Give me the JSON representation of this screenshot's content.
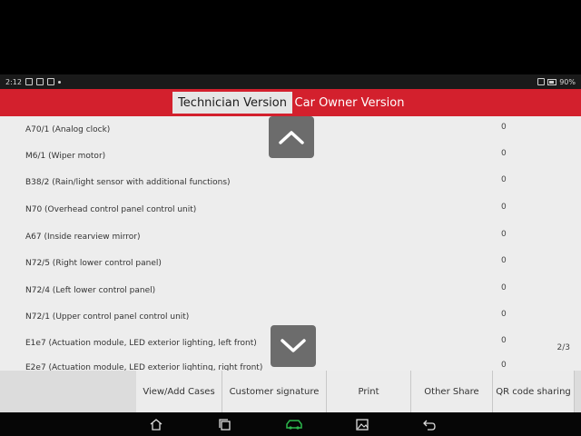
{
  "status_bar": {
    "time": "2:12",
    "battery": "90%"
  },
  "tabs": {
    "technician": "Technician Version",
    "car_owner": "Car Owner Version"
  },
  "rows": [
    {
      "name": "A70/1 (Analog clock)",
      "value": "0"
    },
    {
      "name": "M6/1 (Wiper motor)",
      "value": "0"
    },
    {
      "name": "B38/2 (Rain/light sensor with additional functions)",
      "value": "0"
    },
    {
      "name": "N70 (Overhead control panel control unit)",
      "value": "0"
    },
    {
      "name": "A67 (Inside rearview mirror)",
      "value": "0"
    },
    {
      "name": "N72/5 (Right lower control panel)",
      "value": "0"
    },
    {
      "name": "N72/4 (Left lower control panel)",
      "value": "0"
    },
    {
      "name": "N72/1 (Upper control panel control unit)",
      "value": "0"
    },
    {
      "name": "E1e7 (Actuation module, LED exterior lighting, left front)",
      "value": "0"
    },
    {
      "name": "E2e7 (Actuation module, LED exterior lighting, right front)",
      "value": "0"
    }
  ],
  "page_indicator": "2/3",
  "actions": {
    "view_add_cases": "View/Add Cases",
    "customer_signature": "Customer signature",
    "print": "Print",
    "other_share": "Other Share",
    "qr_code_sharing": "QR code sharing"
  },
  "icons": {
    "scroll_up": "chevron-up-icon",
    "scroll_down": "chevron-down-icon",
    "nav_home": "home-icon",
    "nav_recents": "recents-icon",
    "nav_app": "car-diagnostic-icon",
    "nav_gallery": "gallery-icon",
    "nav_back": "back-icon"
  },
  "colors": {
    "accent": "#d3202d",
    "nav_app": "#2db84d"
  }
}
